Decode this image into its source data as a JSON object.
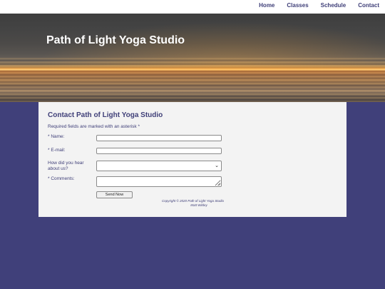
{
  "nav": {
    "items": [
      {
        "label": "Home"
      },
      {
        "label": "Classes"
      },
      {
        "label": "Schedule"
      },
      {
        "label": "Contact"
      }
    ]
  },
  "hero": {
    "title": "Path of Light Yoga Studio"
  },
  "contact": {
    "heading": "Contact Path of Light Yoga Studio",
    "required_note": "Required fields are marked with an asterisk *",
    "fields": {
      "name_label": "* Name:",
      "name_value": "",
      "email_label": "* E-mail:",
      "email_value": "",
      "hear_label": "How did you hear about us?",
      "hear_value": "",
      "comments_label": "* Comments:",
      "comments_value": ""
    },
    "submit_label": "Send Now"
  },
  "footer": {
    "copyright": "Copyright © 2020 Path of Light Yoga Studio",
    "author": "Matt Wildey"
  },
  "colors": {
    "page_bg": "#40407a",
    "accent_text": "#3f3f78",
    "content_bg": "#f3f3f3"
  }
}
